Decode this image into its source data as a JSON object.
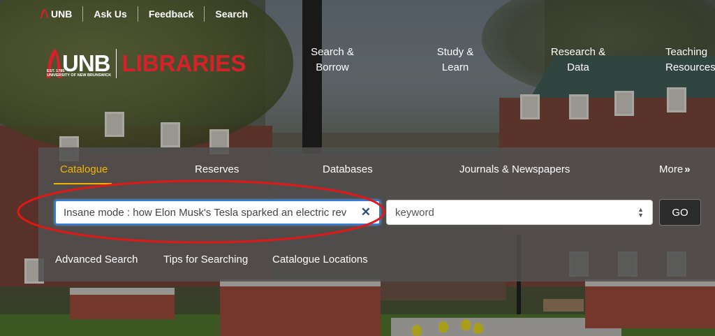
{
  "utility_bar": {
    "brand": "UNB",
    "links": [
      "Ask Us",
      "Feedback",
      "Search"
    ]
  },
  "logo": {
    "unb": "UNB",
    "subtitle_line1": "EST. 1785",
    "subtitle_line2": "UNIVERSITY OF NEW BRUNSWICK",
    "libraries": "LIBRARIES"
  },
  "nav": [
    {
      "line1": "Search &",
      "line2": "Borrow"
    },
    {
      "line1": "Study &",
      "line2": "Learn"
    },
    {
      "line1": "Research &",
      "line2": "Data"
    },
    {
      "line1": "Teaching",
      "line2": "Resources"
    }
  ],
  "search_panel": {
    "tabs": [
      "Catalogue",
      "Reserves",
      "Databases",
      "Journals & Newspapers",
      "More"
    ],
    "active_tab": "Catalogue",
    "more_arrows": "»",
    "query_value": "Insane mode : how Elon Musk's Tesla sparked an electric rev",
    "clear_symbol": "✕",
    "select_value": "keyword",
    "go_label": "GO",
    "links": [
      "Advanced Search",
      "Tips for Searching",
      "Catalogue Locations"
    ]
  },
  "colors": {
    "accent_gold": "#f2b600",
    "brand_red": "#d6212b",
    "focus_blue": "#2f7dd8",
    "annotation_red": "#e01818"
  }
}
